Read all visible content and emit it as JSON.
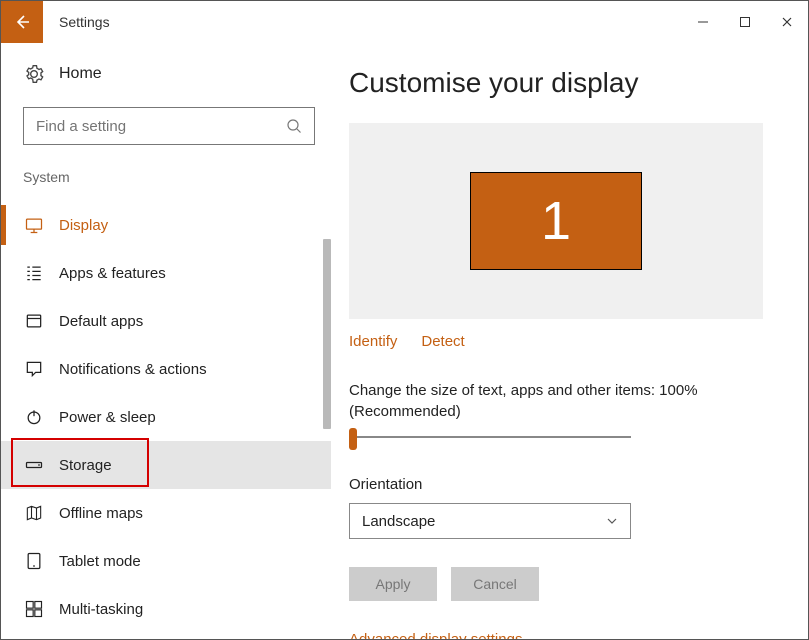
{
  "titlebar": {
    "title": "Settings"
  },
  "sidebar": {
    "home_label": "Home",
    "search_placeholder": "Find a setting",
    "section_label": "System",
    "items": [
      {
        "label": "Display",
        "icon": "display-icon",
        "active": true
      },
      {
        "label": "Apps & features",
        "icon": "apps-icon"
      },
      {
        "label": "Default apps",
        "icon": "default-apps-icon"
      },
      {
        "label": "Notifications & actions",
        "icon": "notifications-icon"
      },
      {
        "label": "Power & sleep",
        "icon": "power-icon"
      },
      {
        "label": "Storage",
        "icon": "storage-icon",
        "hovered": true,
        "highlight": true
      },
      {
        "label": "Offline maps",
        "icon": "maps-icon"
      },
      {
        "label": "Tablet mode",
        "icon": "tablet-icon"
      },
      {
        "label": "Multi-tasking",
        "icon": "multitask-icon"
      }
    ]
  },
  "main": {
    "page_title": "Customise your display",
    "monitor_number": "1",
    "identify_label": "Identify",
    "detect_label": "Detect",
    "scale_label": "Change the size of text, apps and other items: 100% (Recommended)",
    "orientation_label": "Orientation",
    "orientation_value": "Landscape",
    "apply_label": "Apply",
    "cancel_label": "Cancel",
    "advanced_label": "Advanced display settings"
  },
  "colors": {
    "accent": "#c46013"
  }
}
